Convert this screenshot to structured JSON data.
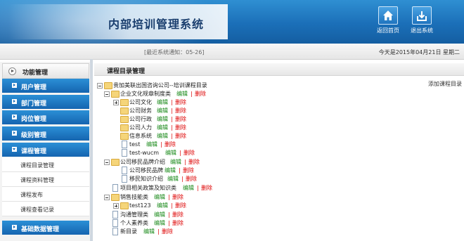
{
  "header": {
    "title": "内部培训管理系统",
    "home_label": "返回首页",
    "logout_label": "退出系统"
  },
  "infobar": {
    "notice": "[最近系统通知：05-26]",
    "date": "今天是2015年04月21日 星期二"
  },
  "sidebar": {
    "head": "功能管理",
    "menus": {
      "users": "用户管理",
      "dept": "部门管理",
      "post": "岗位管理",
      "level": "级别管理",
      "course": "课程管理",
      "basic": "基础数据管理"
    },
    "course_sub": {
      "catalog": "课程目录管理",
      "material": "课程资料管理",
      "publish": "课程发布",
      "view": "课程查看记录"
    }
  },
  "main": {
    "title": "课程目录管理",
    "add_label": "添加课程目录",
    "edit_label": "编辑",
    "sep": "|",
    "delete_label": "删除",
    "tree": {
      "root": "贵加美联出国咨询公司--培训课程目录",
      "n1": "企业文化规章制度类",
      "n1_1": "公司文化",
      "n1_2": "公司财务",
      "n1_3": "公司行政",
      "n1_4": "公司人力",
      "n1_5": "信息系统",
      "n1_6": "test",
      "n1_7": "test-wucm",
      "n2": "公司移民品牌介绍",
      "n2_1": "公司移民品牌",
      "n2_2": "移民知识介绍",
      "n3": "项目相关政策及知识类",
      "n4": "销售技能类",
      "n4_1": "test123",
      "n5": "沟通管理类",
      "n6": "个人素养类",
      "n7": "新目录"
    }
  },
  "colors": {
    "header_blue": "#1b6fb8",
    "menu_blue": "#1565b0",
    "edit_green": "#1a8a1a",
    "delete_red": "#dd0000"
  },
  "icons": {
    "home": "home-icon",
    "logout": "logout-icon",
    "folder": "folder-icon",
    "document": "document-icon"
  }
}
